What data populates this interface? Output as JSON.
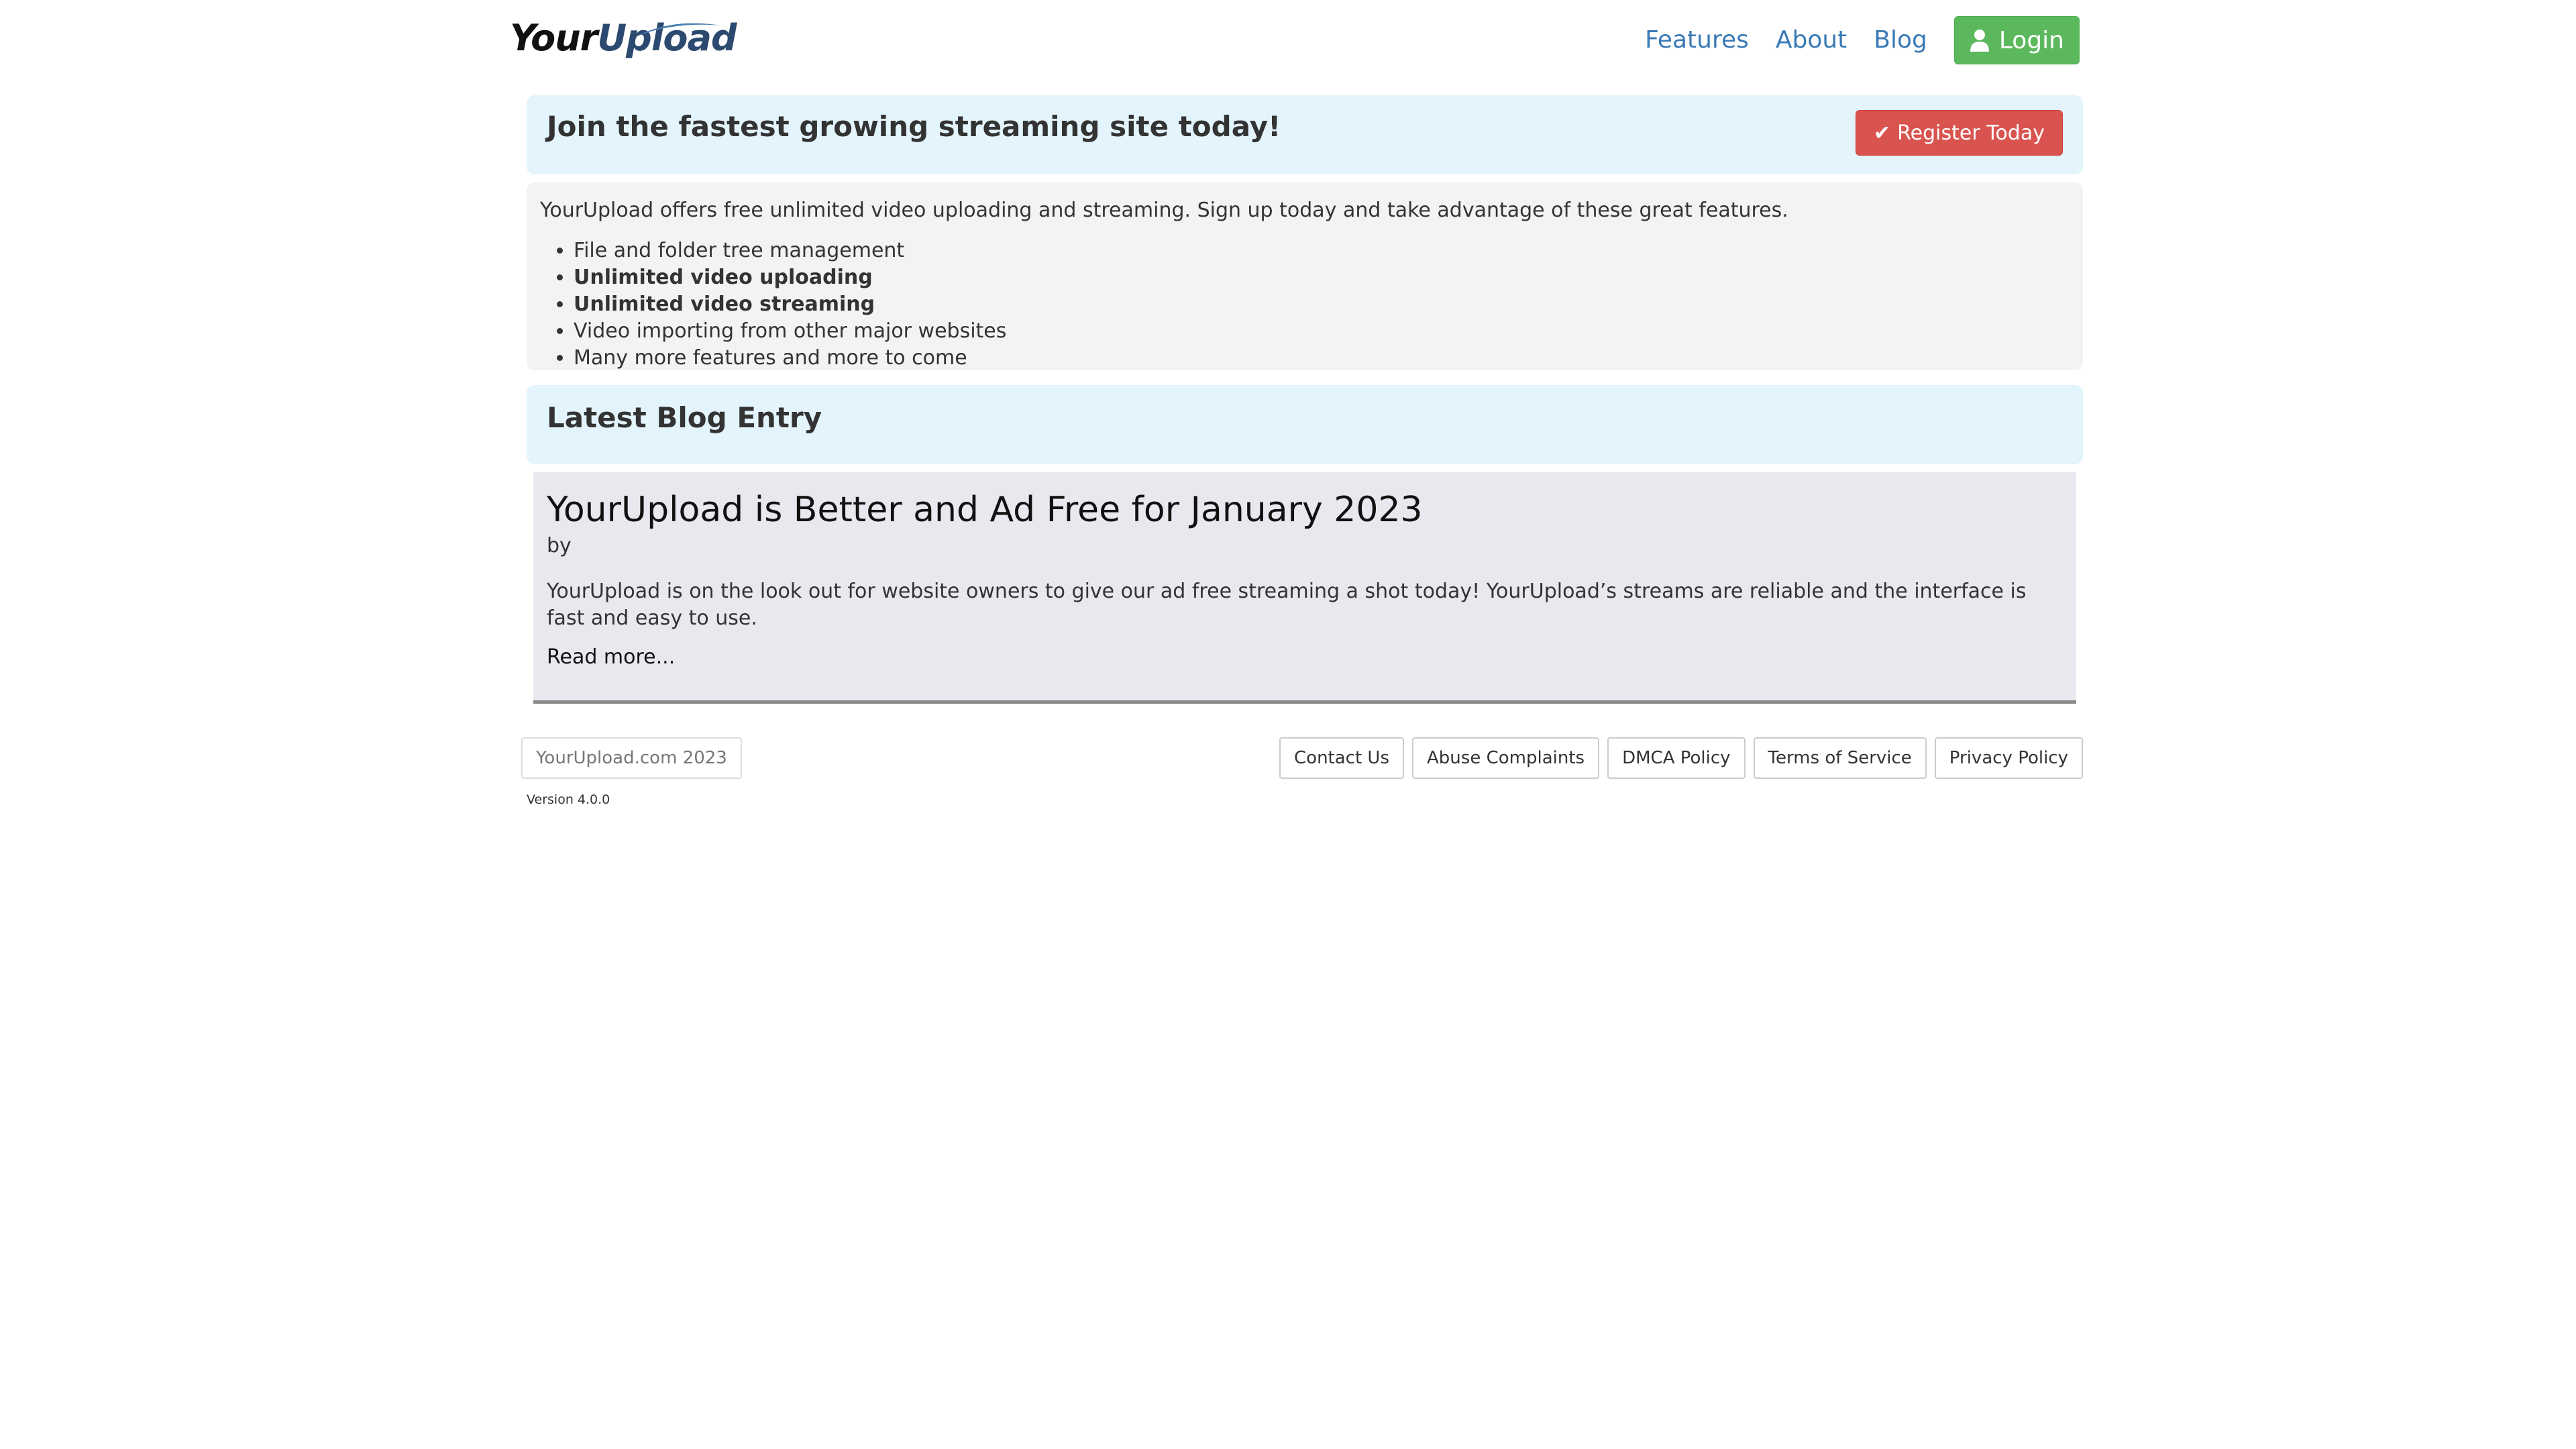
{
  "header": {
    "logo_your": "Your",
    "logo_upload": "Upload",
    "nav": {
      "features": "Features",
      "about": "About",
      "blog": "Blog",
      "login": "Login"
    }
  },
  "join": {
    "title": "Join the fastest growing streaming site today!",
    "register_label": "Register Today"
  },
  "info": {
    "intro": "YourUpload offers free unlimited video uploading and streaming. Sign up today and take advantage of these great features.",
    "features": [
      "File and folder tree management",
      "Unlimited video uploading",
      "Unlimited video streaming",
      "Video importing from other major websites",
      "Many more features and more to come"
    ]
  },
  "blog": {
    "heading": "Latest Blog Entry",
    "entry_title": "YourUpload is Better and Ad Free for January 2023",
    "by": "by",
    "excerpt": "YourUpload is on the look out for website owners to give our ad free streaming a shot today! YourUpload’s streams are reliable and the interface is fast and easy to use.",
    "read_more": "Read more..."
  },
  "footer": {
    "copyright": "YourUpload.com 2023",
    "links": {
      "contact": "Contact Us",
      "abuse": "Abuse Complaints",
      "dmca": "DMCA Policy",
      "terms": "Terms of Service",
      "privacy": "Privacy Policy"
    },
    "version": "Version 4.0.0"
  },
  "colors": {
    "nav_link": "#3a7ab5",
    "login_button": "#5cb85c",
    "register_button": "#d9534f",
    "panel_heading_bg": "#e3f4fc",
    "well_bg": "#f3f3f3",
    "blog_card_bg": "#e8e8ee"
  },
  "icons": {
    "login": "user-icon",
    "register": "check-icon"
  }
}
